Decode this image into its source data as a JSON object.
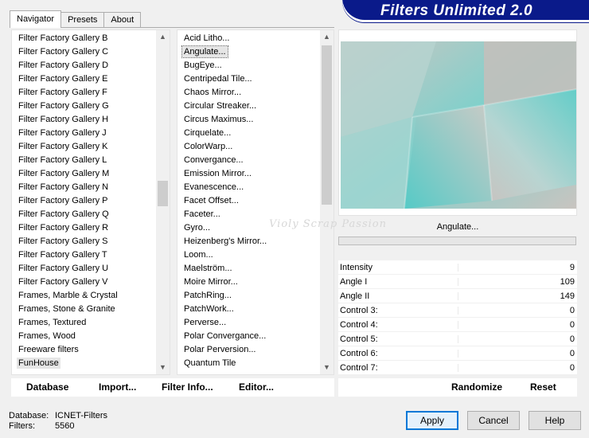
{
  "window": {
    "title": "Filters Unlimited 2.0"
  },
  "tabs": [
    {
      "label": "Navigator",
      "active": true
    },
    {
      "label": "Presets",
      "active": false
    },
    {
      "label": "About",
      "active": false
    }
  ],
  "categories": [
    "Filter Factory Gallery B",
    "Filter Factory Gallery C",
    "Filter Factory Gallery D",
    "Filter Factory Gallery E",
    "Filter Factory Gallery F",
    "Filter Factory Gallery G",
    "Filter Factory Gallery H",
    "Filter Factory Gallery J",
    "Filter Factory Gallery K",
    "Filter Factory Gallery L",
    "Filter Factory Gallery M",
    "Filter Factory Gallery N",
    "Filter Factory Gallery P",
    "Filter Factory Gallery Q",
    "Filter Factory Gallery R",
    "Filter Factory Gallery S",
    "Filter Factory Gallery T",
    "Filter Factory Gallery U",
    "Filter Factory Gallery V",
    "Frames, Marble & Crystal",
    "Frames, Stone & Granite",
    "Frames, Textured",
    "Frames, Wood",
    "Freeware filters",
    "FunHouse"
  ],
  "selected_category": "FunHouse",
  "filters": [
    "Acid Litho...",
    "Angulate...",
    "BugEye...",
    "Centripedal Tile...",
    "Chaos Mirror...",
    "Circular Streaker...",
    "Circus Maximus...",
    "Cirquelate...",
    "ColorWarp...",
    "Convergance...",
    "Emission Mirror...",
    "Evanescence...",
    "Facet Offset...",
    "Faceter...",
    "Gyro...",
    "Heizenberg's Mirror...",
    "Loom...",
    "Maelström...",
    "Moire Mirror...",
    "PatchRing...",
    "PatchWork...",
    "Perverse...",
    "Polar Convergance...",
    "Polar Perversion...",
    "Quantum Tile"
  ],
  "selected_filter": "Angulate...",
  "preview": {
    "filter_name": "Angulate...",
    "watermark": "Violy Scrap Passion"
  },
  "controls": [
    {
      "label": "Intensity",
      "value": "9"
    },
    {
      "label": "Angle I",
      "value": "109"
    },
    {
      "label": "Angle II",
      "value": "149"
    },
    {
      "label": "Control 3:",
      "value": "0"
    },
    {
      "label": "Control 4:",
      "value": "0"
    },
    {
      "label": "Control 5:",
      "value": "0"
    },
    {
      "label": "Control 6:",
      "value": "0"
    },
    {
      "label": "Control 7:",
      "value": "0"
    }
  ],
  "toolbar": {
    "database": "Database",
    "import": "Import...",
    "filter_info": "Filter Info...",
    "editor": "Editor...",
    "randomize": "Randomize",
    "reset": "Reset"
  },
  "status": {
    "database_label": "Database:",
    "database_value": "ICNET-Filters",
    "filters_label": "Filters:",
    "filters_value": "5560"
  },
  "buttons": {
    "apply": "Apply",
    "cancel": "Cancel",
    "help": "Help"
  },
  "colors": {
    "banner": "#0a1a8a",
    "preview_teal": "#8ec9c6",
    "preview_gray": "#c6bfbc",
    "default_button_border": "#0078d7"
  }
}
